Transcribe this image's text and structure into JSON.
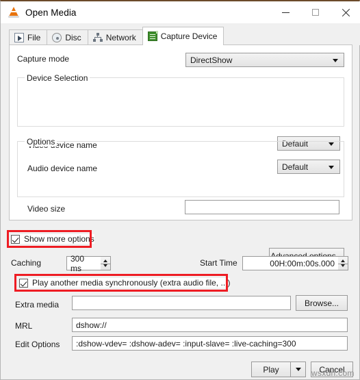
{
  "window": {
    "title": "Open Media",
    "app_icon": "vlc-cone-icon",
    "controls": {
      "minimize": "minimize-icon",
      "maximize": "maximize-icon",
      "close": "close-icon"
    }
  },
  "tabs": [
    {
      "label": "File",
      "icon": "file-icon",
      "active": false
    },
    {
      "label": "Disc",
      "icon": "disc-icon",
      "active": false
    },
    {
      "label": "Network",
      "icon": "network-icon",
      "active": false
    },
    {
      "label": "Capture Device",
      "icon": "capture-device-icon",
      "active": true
    }
  ],
  "capture": {
    "mode_label": "Capture mode",
    "mode_value": "DirectShow",
    "device_selection": {
      "group_title": "Device Selection",
      "video_label": "Video device name",
      "video_value": "Default",
      "audio_label": "Audio device name",
      "audio_value": "Default"
    },
    "options": {
      "group_title": "Options",
      "video_size_label": "Video size",
      "video_size_value": "",
      "video_size_placeholder": ""
    },
    "advanced_button": "Advanced options..."
  },
  "more_options": {
    "show_more_label": "Show more options",
    "show_more_checked": true,
    "caching_label": "Caching",
    "caching_value": "300 ms",
    "start_time_label": "Start Time",
    "start_time_value": "00H:00m:00s.000",
    "sync_label": "Play another media synchronously (extra audio file, ...)",
    "sync_checked": true,
    "extra_media_label": "Extra media",
    "extra_media_value": "",
    "browse_button": "Browse...",
    "mrl_label": "MRL",
    "mrl_value": "dshow://",
    "edit_options_label": "Edit Options",
    "edit_options_value": ":dshow-vdev= :dshow-adev=  :input-slave= :live-caching=300"
  },
  "footer": {
    "play_button": "Play",
    "play_dropdown_icon": "chevron-down-icon",
    "cancel_button": "Cancel"
  },
  "watermark": "wsxdn.com",
  "colors": {
    "annotation": "#ee1c23",
    "accent": "#e8730c",
    "window_bg": "#f0f0f0",
    "page_bg": "#ffffff"
  }
}
